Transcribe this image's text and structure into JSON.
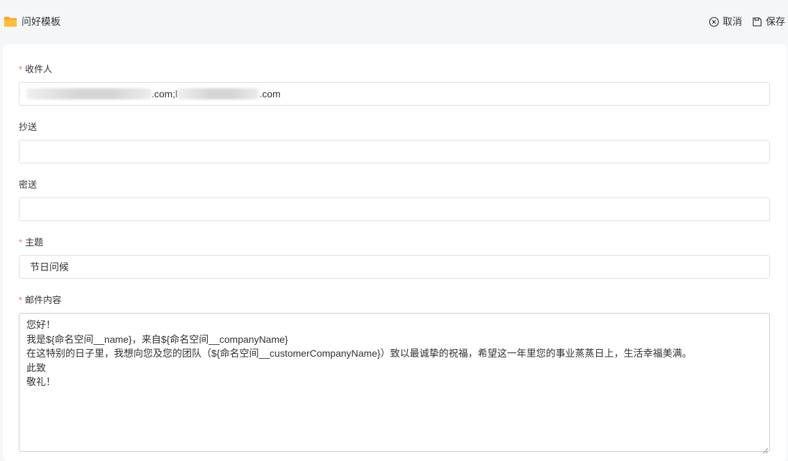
{
  "header": {
    "title": "问好模板",
    "icon": "folder-icon",
    "cancel_label": "取消",
    "cancel_icon": "close-circle-icon",
    "save_label": "保存",
    "save_icon": "save-icon"
  },
  "form": {
    "recipients": {
      "label": "收件人",
      "required": true,
      "value_part1": ".com;l",
      "value_part2": ".com"
    },
    "cc": {
      "label": "抄送",
      "required": false,
      "value": ""
    },
    "bcc": {
      "label": "密送",
      "required": false,
      "value": ""
    },
    "subject": {
      "label": "主题",
      "required": true,
      "value": "节日问候"
    },
    "content": {
      "label": "邮件内容",
      "required": true,
      "lines": [
        "您好！",
        "我是${命名空间__name}，来自${命名空间__companyName}",
        "在这特别的日子里，我想向您及您的团队（${命名空间__customerCompanyName}）致以最诚挚的祝福，希望这一年里您的事业蒸蒸日上，生活幸福美满。",
        "此致",
        "敬礼！"
      ]
    },
    "required_mark": "*"
  },
  "colors": {
    "required": "#f56c6c",
    "folder": "#f7a928",
    "border": "#dcdfe6"
  }
}
